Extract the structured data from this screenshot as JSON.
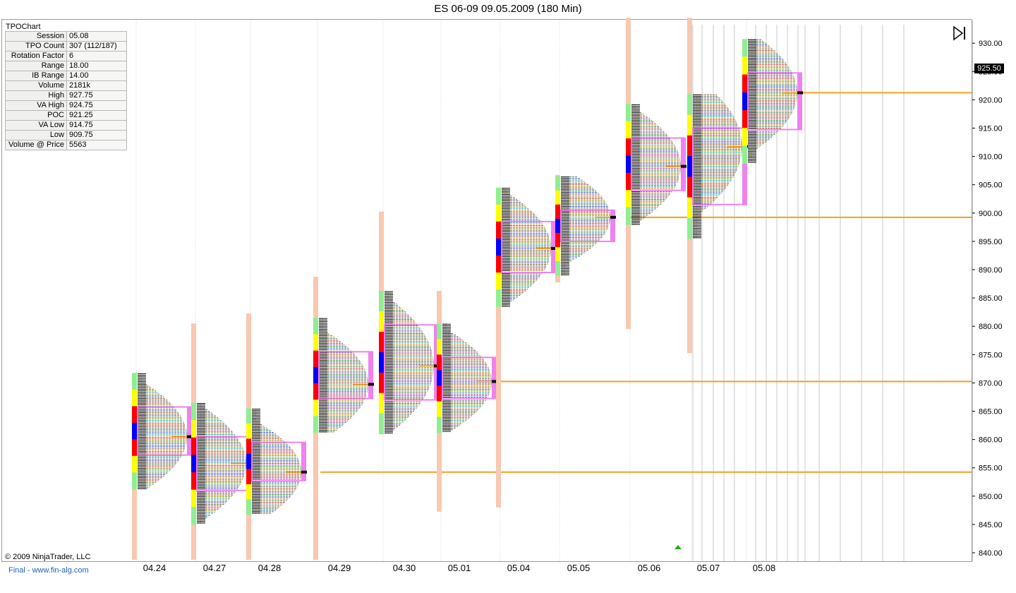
{
  "window": {
    "title": "ES 06-09  09.05.2009 (180 Min)"
  },
  "info_panel": {
    "title": "TPOChart",
    "rows": [
      {
        "label": "Session",
        "value": "05.08"
      },
      {
        "label": "TPO Count",
        "value": "307 (112/187)"
      },
      {
        "label": "Rotation Factor",
        "value": "6"
      },
      {
        "label": "Range",
        "value": "18.00"
      },
      {
        "label": "IB Range",
        "value": "14.00"
      },
      {
        "label": "Volume",
        "value": "2181k"
      },
      {
        "label": "High",
        "value": "927.75"
      },
      {
        "label": "VA High",
        "value": "924.75"
      },
      {
        "label": "POC",
        "value": "921.25"
      },
      {
        "label": "VA Low",
        "value": "914.75"
      },
      {
        "label": "Low",
        "value": "909.75"
      },
      {
        "label": "Volume @ Price",
        "value": "5563"
      }
    ]
  },
  "footer": {
    "copyright": "© 2009 NinjaTrader, LLC",
    "link_text": "Final - www.fin-alg.com"
  },
  "current_price_label": "925.50",
  "icons": {
    "goto_end": "skip-to-end-icon",
    "marker": "triangle-up-icon"
  },
  "colors": {
    "value_area_box": "#ee82ee",
    "naked_poc_line": "#f0a020",
    "ib_yellow": "#ffff00",
    "ib_green": "#90ee90",
    "ib_red": "#ff0000",
    "ib_blue": "#0000ff",
    "range_extension": "#f8c8b0",
    "marker_green": "#22aa22"
  },
  "chart_data": {
    "type": "tpo_profile",
    "y_ticks": [
      "930.00",
      "925.00",
      "920.00",
      "915.00",
      "910.00",
      "905.00",
      "900.00",
      "895.00",
      "890.00",
      "885.00",
      "880.00",
      "875.00",
      "870.00",
      "865.00",
      "860.00",
      "855.00",
      "850.00",
      "845.00",
      "840.00"
    ],
    "ylim": [
      838.75,
      934.5
    ],
    "sessions": [
      {
        "date": "04.24",
        "high": 866.75,
        "low": 838.75,
        "va_high": 865.75,
        "va_low": 857.25,
        "poc": 860.5
      },
      {
        "date": "04.27",
        "high": 880.5,
        "low": 838.75,
        "va_high": 860.5,
        "va_low": 851.0,
        "poc": 855.75
      },
      {
        "date": "04.28",
        "high": 882.25,
        "low": 838.75,
        "va_high": 859.5,
        "va_low": 852.75,
        "poc": 854.25
      },
      {
        "date": "04.29",
        "high": 888.75,
        "low": 838.75,
        "va_high": 875.5,
        "va_low": 867.25,
        "poc": 869.75
      },
      {
        "date": "04.30",
        "high": 900.25,
        "low": 861.5,
        "va_high": 880.25,
        "va_low": 867.0,
        "poc": 873.0
      },
      {
        "date": "05.01",
        "high": 886.25,
        "low": 847.25,
        "va_high": 874.5,
        "va_low": 867.25,
        "poc": 870.25
      },
      {
        "date": "05.04",
        "high": 896.0,
        "low": 848.0,
        "va_high": 898.5,
        "va_low": 889.5,
        "poc": 893.75
      },
      {
        "date": "05.05",
        "high": 906.75,
        "low": 887.75,
        "va_high": 900.5,
        "va_low": 895.0,
        "poc": 899.25
      },
      {
        "date": "05.06",
        "high": 934.5,
        "low": 879.5,
        "va_high": 913.25,
        "va_low": 904.0,
        "poc": 908.25
      },
      {
        "date": "05.07",
        "high": 934.5,
        "low": 875.25,
        "va_high": 915.0,
        "va_low": 901.5,
        "poc": 911.75
      },
      {
        "date": "05.08",
        "high": 927.75,
        "low": 909.75,
        "va_high": 924.75,
        "va_low": 914.75,
        "poc": 921.25
      }
    ],
    "naked_poc_lines": [
      921.25,
      899.25,
      870.25,
      854.25
    ],
    "current_price": 925.5
  }
}
